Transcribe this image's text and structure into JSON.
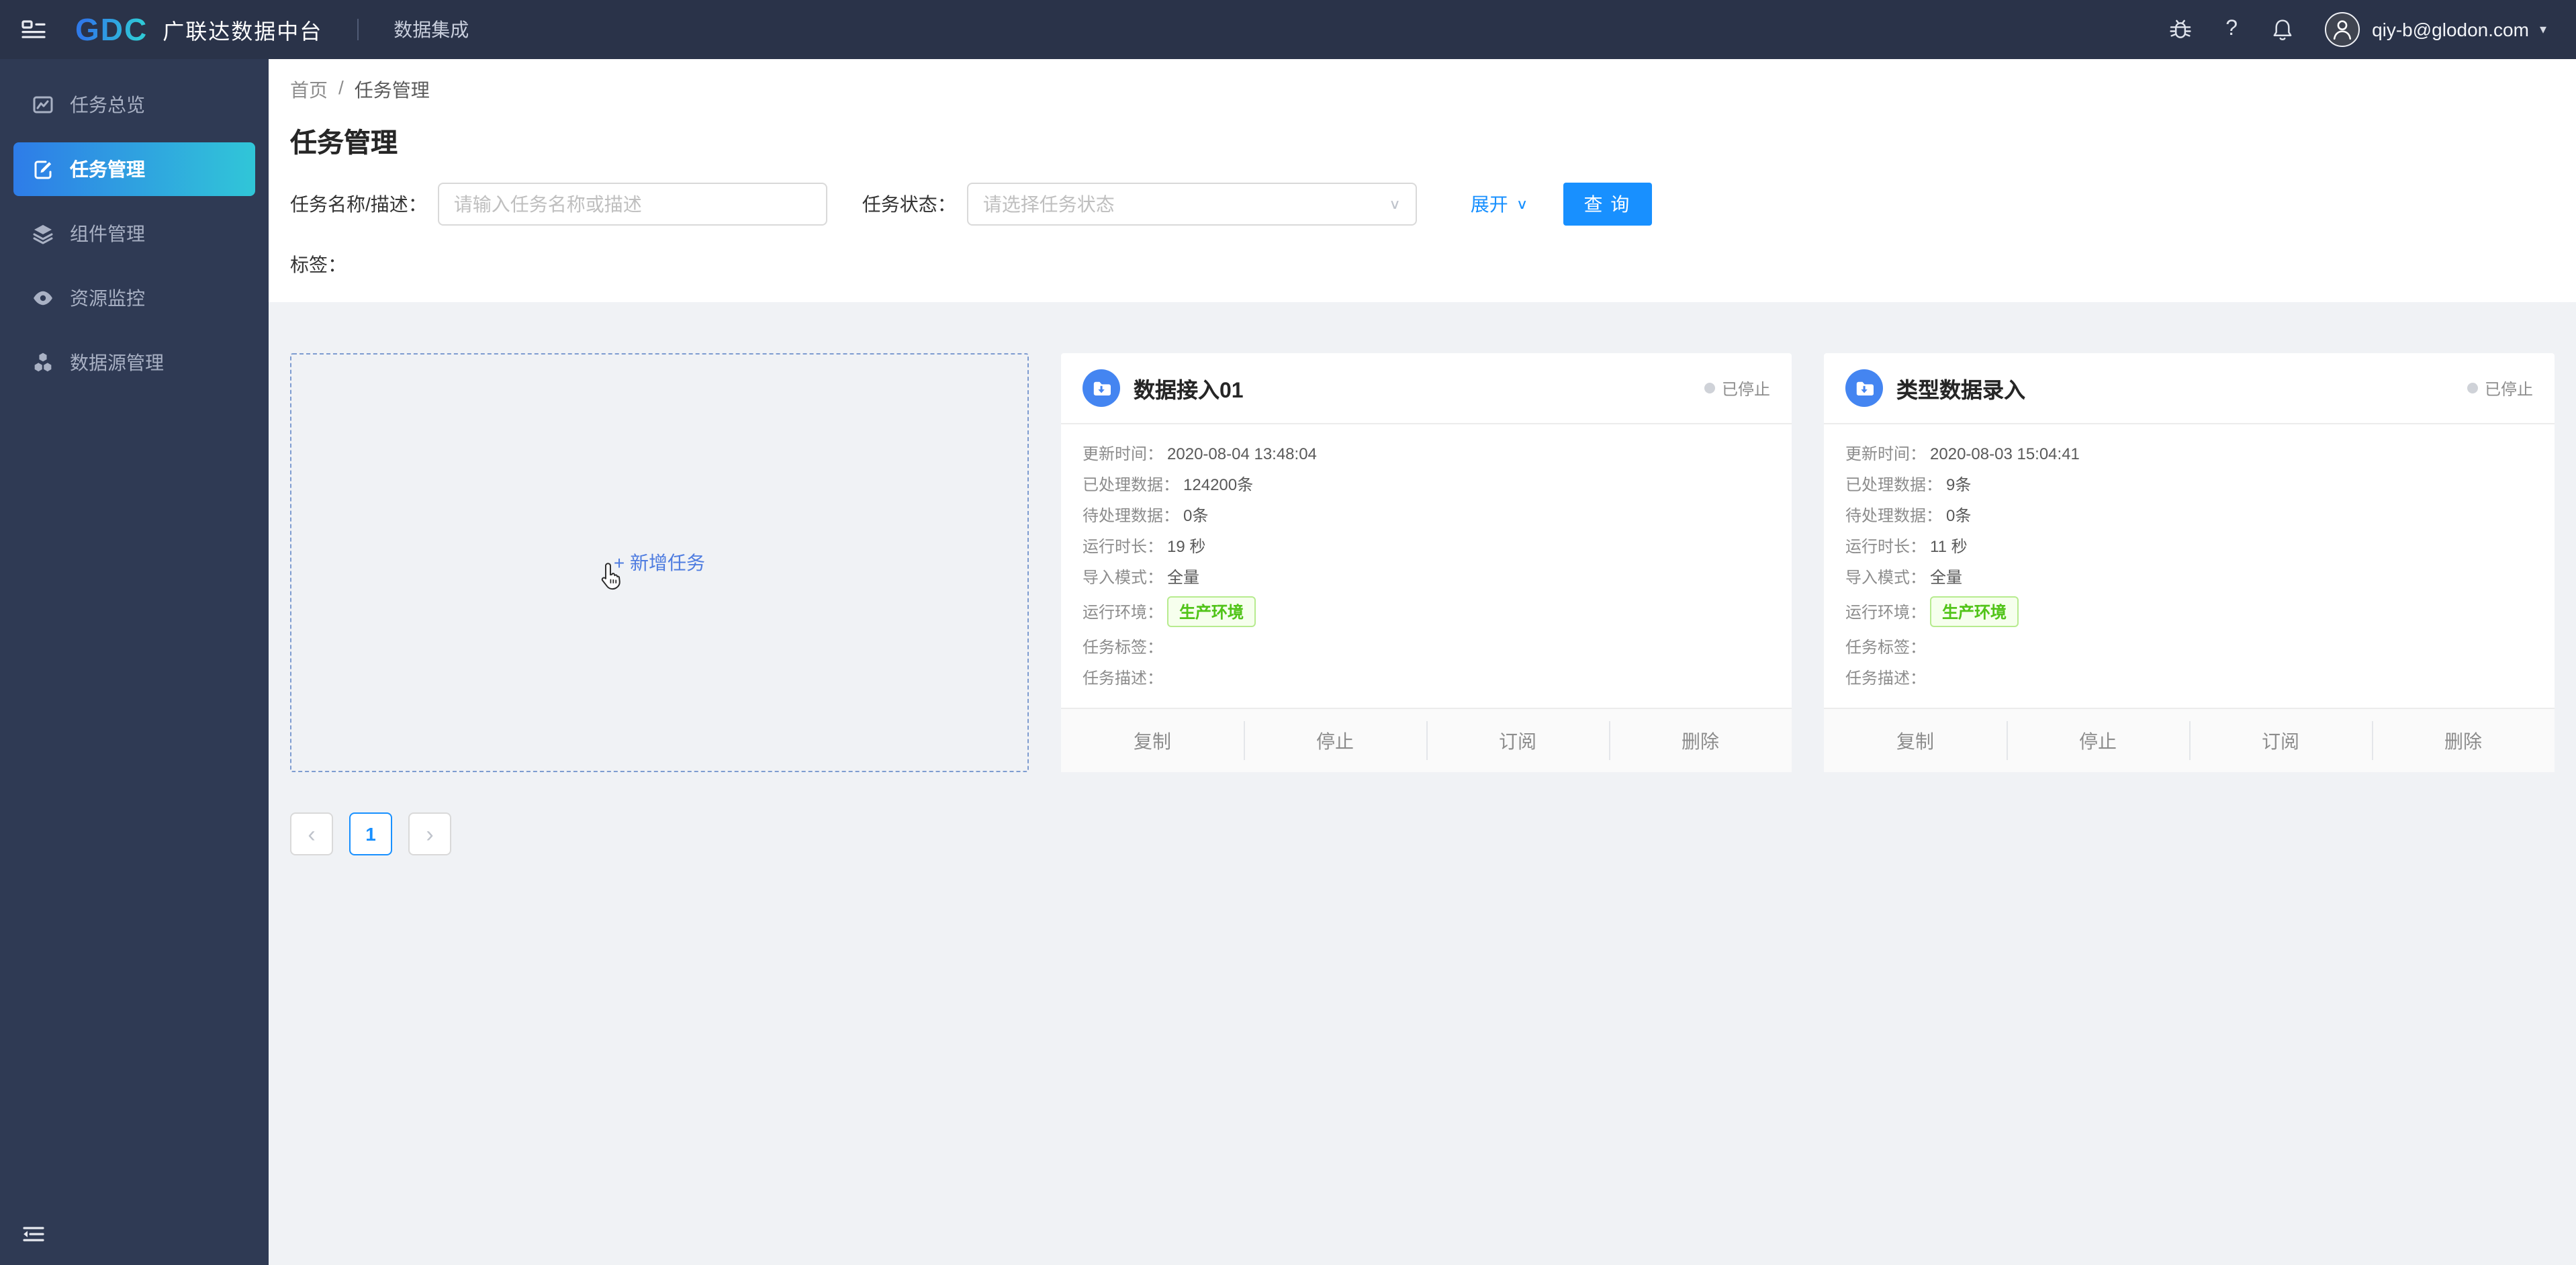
{
  "colors": {
    "header_bg": "#2a3349",
    "sidebar_bg": "#2f3a54",
    "active_item_gradient_start": "#2e7ce8",
    "active_item_gradient_end": "#30c6d8",
    "primary_blue": "#1890ff",
    "card_icon_blue": "#4485f1",
    "tag_green_text": "#52c41a",
    "tag_green_bg": "#f6ffed",
    "tag_green_border": "#b7eb8f",
    "page_bg": "#f0f2f5",
    "status_dot_gray": "#cfd2d8"
  },
  "header": {
    "logo": "GDC",
    "product": "广联达数据中台",
    "module": "数据集成",
    "help_icon": "?",
    "user_email": "qiy-b@glodon.com",
    "caret_icon": "▾"
  },
  "sidebar": {
    "items": [
      {
        "label": "任务总览"
      },
      {
        "label": "任务管理"
      },
      {
        "label": "组件管理"
      },
      {
        "label": "资源监控"
      },
      {
        "label": "数据源管理"
      }
    ]
  },
  "breadcrumb": {
    "home": "首页",
    "separator": "/",
    "current": "任务管理"
  },
  "page": {
    "title": "任务管理"
  },
  "filters": {
    "name_label": "任务名称/描述：",
    "name_placeholder": "请输入任务名称或描述",
    "status_label": "任务状态：",
    "status_placeholder": "请选择任务状态",
    "status_caret": "∨",
    "expand_label": "展开",
    "expand_caret": "∨",
    "search_button": "查 询",
    "tags_label": "标签："
  },
  "add_card": {
    "label": "+ 新增任务"
  },
  "cards": [
    {
      "title": "数据接入01",
      "status": "已停止",
      "rows": [
        {
          "label": "更新时间：",
          "value": "2020-08-04 13:48:04"
        },
        {
          "label": "已处理数据：",
          "value": "124200条"
        },
        {
          "label": "待处理数据：",
          "value": "0条"
        },
        {
          "label": "运行时长：",
          "value": "19 秒"
        },
        {
          "label": "导入模式：",
          "value": "全量"
        },
        {
          "label": "运行环境：",
          "value": "生产环境"
        },
        {
          "label": "任务标签：",
          "value": ""
        },
        {
          "label": "任务描述：",
          "value": ""
        }
      ],
      "actions": [
        "复制",
        "停止",
        "订阅",
        "删除"
      ]
    },
    {
      "title": "类型数据录入",
      "status": "已停止",
      "rows": [
        {
          "label": "更新时间：",
          "value": "2020-08-03 15:04:41"
        },
        {
          "label": "已处理数据：",
          "value": "9条"
        },
        {
          "label": "待处理数据：",
          "value": "0条"
        },
        {
          "label": "运行时长：",
          "value": "11 秒"
        },
        {
          "label": "导入模式：",
          "value": "全量"
        },
        {
          "label": "运行环境：",
          "value": "生产环境"
        },
        {
          "label": "任务标签：",
          "value": ""
        },
        {
          "label": "任务描述：",
          "value": ""
        }
      ],
      "actions": [
        "复制",
        "停止",
        "订阅",
        "删除"
      ]
    }
  ],
  "pagination": {
    "prev_icon": "‹",
    "current_page": "1",
    "next_icon": "›"
  }
}
